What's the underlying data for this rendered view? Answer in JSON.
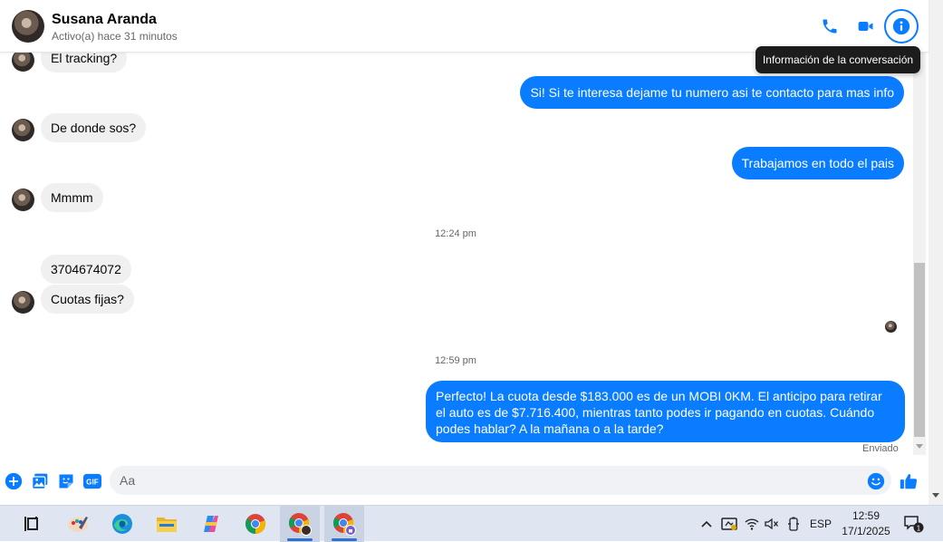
{
  "contact": {
    "name": "Susana Aranda",
    "status": "Activo(a) hace 31 minutos"
  },
  "header_actions": {
    "call_icon": "phone-icon",
    "video_icon": "video-camera-icon",
    "info_icon": "info-icon"
  },
  "tooltip": "Información de la conversación",
  "messages": {
    "in_1": "El tracking?",
    "out_1": "Si! Si te interesa dejame tu numero asi te contacto para mas info",
    "in_2": "De donde sos?",
    "out_2": "Trabajamos en todo el pais",
    "in_3": "Mmmm",
    "time_1": "12:24 pm",
    "in_4": "3704674072",
    "in_5": "Cuotas fijas?",
    "time_2": "12:59 pm",
    "out_3": "Perfecto! La cuota desde $183.000 es de un MOBI 0KM. El anticipo para retirar el auto es de $7.716.400, mientras tanto podes ir pagando en cuotas. Cuándo podes hablar? A la mañana o a la tarde?",
    "sent_status": "Enviado"
  },
  "composer": {
    "placeholder": "Aa",
    "gif_label": "GIF",
    "icons": [
      "plus-icon",
      "image-icon",
      "sticker-icon",
      "gif-icon",
      "emoji-icon",
      "thumbs-up-icon"
    ]
  },
  "taskbar": {
    "apps": [
      "task-view-icon",
      "paint-icon",
      "edge-icon",
      "file-explorer-icon",
      "copilot-icon",
      "chrome-icon",
      "chrome-profile-icon",
      "chrome-profile-2-icon"
    ],
    "language": "ESP",
    "time": "12:59",
    "date": "17/1/2025",
    "notification_count": "1"
  },
  "colors": {
    "accent": "#0a7cff",
    "incoming_bubble": "#f0f0f0",
    "tooltip_bg": "#1c1c1c",
    "taskbar_bg": "#dfe6f1"
  }
}
